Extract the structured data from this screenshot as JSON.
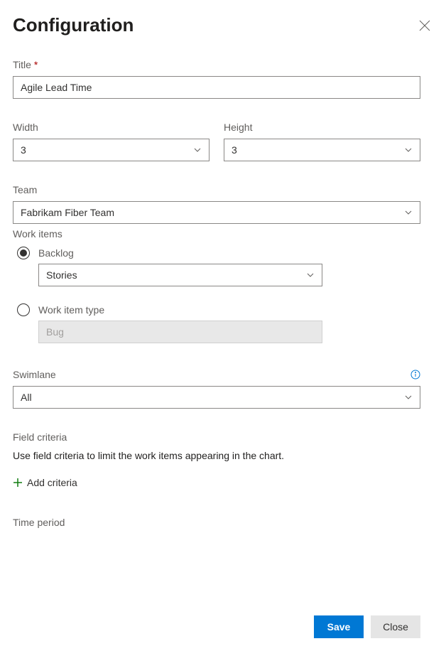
{
  "panel": {
    "title": "Configuration"
  },
  "title_field": {
    "label": "Title",
    "value": "Agile Lead Time"
  },
  "width_field": {
    "label": "Width",
    "value": "3"
  },
  "height_field": {
    "label": "Height",
    "value": "3"
  },
  "team_field": {
    "label": "Team",
    "value": "Fabrikam Fiber Team"
  },
  "work_items": {
    "heading": "Work items",
    "backlog": {
      "label": "Backlog",
      "value": "Stories"
    },
    "wit": {
      "label": "Work item type",
      "value": "Bug"
    }
  },
  "swimlane": {
    "label": "Swimlane",
    "value": "All"
  },
  "field_criteria": {
    "heading": "Field criteria",
    "description": "Use field criteria to limit the work items appearing in the chart.",
    "add_label": "Add criteria"
  },
  "time_period": {
    "heading": "Time period"
  },
  "footer": {
    "save": "Save",
    "close": "Close"
  }
}
